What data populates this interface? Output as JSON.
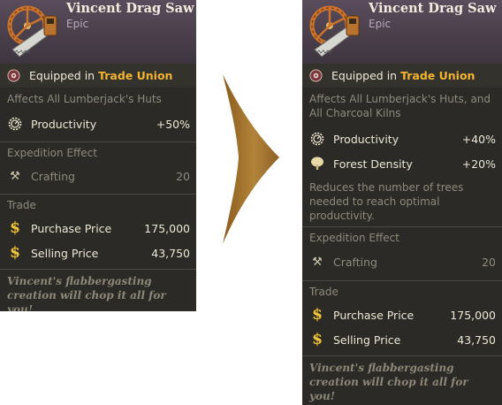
{
  "before": {
    "item_name": "Vincent Drag Saw",
    "rarity": "Epic",
    "equipped_prefix": "Equipped in",
    "equipped_org": "Trade Union",
    "affects": "Affects All Lumberjack's Huts",
    "stats": [
      {
        "icon": "productivity-gear-icon",
        "label": "Productivity",
        "value": "+50%"
      }
    ],
    "expedition_title": "Expedition Effect",
    "expedition_label": "Crafting",
    "expedition_value": "20",
    "trade_title": "Trade",
    "purchase_label": "Purchase Price",
    "purchase_value": "175,000",
    "selling_label": "Selling Price",
    "selling_value": "43,750",
    "flavor": "Vincent's flabbergasting creation will chop it all for you!"
  },
  "after": {
    "item_name": "Vincent Drag Saw",
    "rarity": "Epic",
    "equipped_prefix": "Equipped in",
    "equipped_org": "Trade Union",
    "affects": "Affects All Lumberjack's Huts, and All Charcoal Kilns",
    "stats": [
      {
        "icon": "productivity-gear-icon",
        "label": "Productivity",
        "value": "+40%"
      },
      {
        "icon": "forest-tree-icon",
        "label": "Forest Density",
        "value": "+20%"
      }
    ],
    "description": "Reduces the number of trees needed to reach optimal productivity.",
    "expedition_title": "Expedition Effect",
    "expedition_label": "Crafting",
    "expedition_value": "20",
    "trade_title": "Trade",
    "purchase_label": "Purchase Price",
    "purchase_value": "175,000",
    "selling_label": "Selling Price",
    "selling_value": "43,750",
    "flavor": "Vincent's flabbergasting creation will chop it all for you!"
  },
  "coin_symbol": "$",
  "colors": {
    "panel_bg": "#2b2a26",
    "header_purple": "#4a3f4b",
    "org_gold": "#f2b431",
    "coin_gold": "#f0c640",
    "arrow_brown": "#a6772f"
  }
}
